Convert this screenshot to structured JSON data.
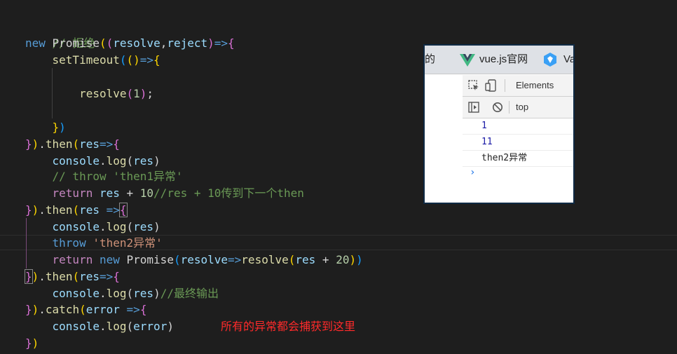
{
  "code": {
    "comment_reject": "// 拒绝",
    "new_kw": "new",
    "promise_name": "Promise",
    "resolve_param": "resolve",
    "reject_param": "reject",
    "arrow": "=>",
    "set_timeout": "setTimeout",
    "resolve_call": "resolve",
    "num_1": "1",
    "then": "then",
    "res": "res",
    "console": "console",
    "log": "log",
    "comment_throw": "// throw 'then1异常'",
    "return_kw": "return",
    "num_10": "10",
    "comment_pass": "//res + 10传到下一个then",
    "throw_kw": "throw",
    "str_then2": "'then2异常'",
    "num_20": "20",
    "comment_final": "//最终输出",
    "catch": "catch",
    "error": "error"
  },
  "annotation": "所有的异常都会捕获到这里",
  "devtools": {
    "tab_left_partial": "的",
    "tab_vue_label": "vue.js官网",
    "tab_va_partial": "Va",
    "elements_tab": "Elements",
    "context_label": "top",
    "console_output": [
      "1",
      "11",
      "then2异常"
    ],
    "prompt_symbol": "›"
  },
  "colors": {
    "editor_bg": "#1e1e1e",
    "annotation": "#ff2a2a",
    "console_number": "#1a1aa6",
    "vue_green": "#41b883"
  }
}
